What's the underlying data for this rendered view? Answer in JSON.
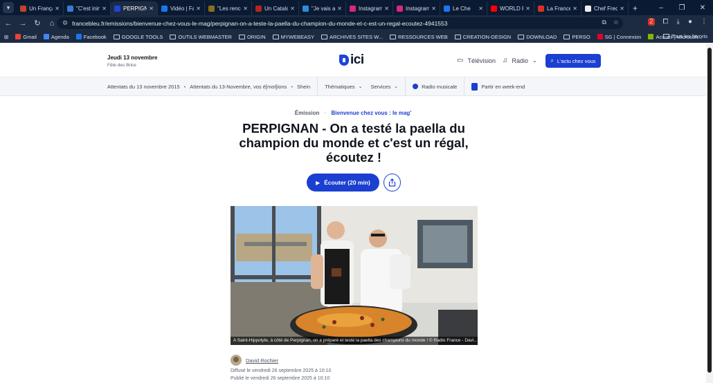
{
  "browser": {
    "tabs": [
      {
        "title": "Un Françai",
        "color": "#c1432e",
        "active": false
      },
      {
        "title": "\"C'est inim",
        "color": "#3a7bd5",
        "active": false
      },
      {
        "title": "PERPIGNA",
        "color": "#1b46d8",
        "active": true
      },
      {
        "title": "Vidéo | Fa",
        "color": "#1877f2",
        "active": false
      },
      {
        "title": "\"Les renco",
        "color": "#8a6d1d",
        "active": false
      },
      {
        "title": "Un Catala",
        "color": "#b3261e",
        "active": false
      },
      {
        "title": "\"Je vais aj",
        "color": "#2b8ed6",
        "active": false
      },
      {
        "title": "Instagram",
        "color": "#d62976",
        "active": false
      },
      {
        "title": "Instagram",
        "color": "#d62976",
        "active": false
      },
      {
        "title": "Le Che",
        "color": "#1877f2",
        "active": false
      },
      {
        "title": "WORLD P",
        "color": "#ff0000",
        "active": false
      },
      {
        "title": "La France",
        "color": "#d93025",
        "active": false
      },
      {
        "title": "Chef Fredi",
        "color": "#eeeeee",
        "active": false
      }
    ],
    "new_tab": "+",
    "url": "francebleu.fr/emissions/bienvenue-chez-vous-le-mag/perpignan-on-a-teste-la-paella-du-champion-du-monde-et-c-est-un-regal-ecoutez-4941553",
    "extension_badge": "2",
    "bookmarks": [
      {
        "label": "Gmail",
        "kind": "icon",
        "color": "#ea4335"
      },
      {
        "label": "Agenda",
        "kind": "icon",
        "color": "#4285f4"
      },
      {
        "label": "Facebook",
        "kind": "icon",
        "color": "#1877f2"
      },
      {
        "label": "GOOGLE TOOLS",
        "kind": "folder"
      },
      {
        "label": "OUTILS WEBMASTER",
        "kind": "folder"
      },
      {
        "label": "ORIGIN",
        "kind": "folder"
      },
      {
        "label": "MYWEBEASY",
        "kind": "folder"
      },
      {
        "label": "ARCHIVES SITES W...",
        "kind": "folder"
      },
      {
        "label": "RESSOURCES WEB",
        "kind": "folder"
      },
      {
        "label": "CREATION-DESIGN",
        "kind": "folder"
      },
      {
        "label": "DOWNLOAD",
        "kind": "folder"
      },
      {
        "label": "PERSO",
        "kind": "folder"
      },
      {
        "label": "SG | Connexion",
        "kind": "icon",
        "color": "#e60028"
      },
      {
        "label": "Accueil | Microsoft...",
        "kind": "icon",
        "color": "#7fba00"
      }
    ],
    "all_bookmarks": "Tous les favoris"
  },
  "header": {
    "date": "Jeudi 13 novembre",
    "saint": "Fête des Brice",
    "logo_word": "ici",
    "brand_color": "#1b46d8",
    "tv_label": "Télévision",
    "radio_label": "Radio",
    "cta_label": "L'actu chez vous"
  },
  "subnav": {
    "links": [
      "Attentats du 13 novembre 2015",
      "Attentats du 13-Novembre, vos é[mot]ions",
      "Shein"
    ],
    "thematiques": "Thématiques",
    "services": "Services",
    "radio_musicale": "Radio musicale",
    "partir": "Partir en week-end"
  },
  "article": {
    "kind": "Émission",
    "separator": "·",
    "show": "Bienvenue chez vous : le mag'",
    "title": "PERPIGNAN - On a testé la paella du champion du monde et c'est un régal, écoutez !",
    "listen_label": "Écouter (20 min)",
    "caption": "A Saint-Hippolyte, à côté de Perpignan, on a préparé et testé la paella des champions du monde ! © Radio France - Davi...",
    "author": "David Rochier",
    "published": "Diffusé le vendredi 26 septembre 2025 à 10:10",
    "updated": "Publié le vendredi 26 septembre 2025 à 10:10"
  }
}
